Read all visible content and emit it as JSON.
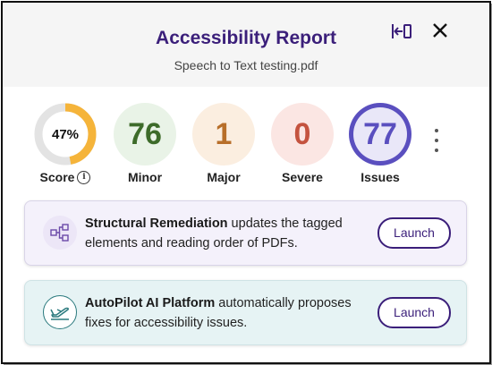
{
  "header": {
    "title": "Accessibility Report",
    "subtitle": "Speech to Text testing.pdf"
  },
  "metrics": [
    {
      "value": "47%",
      "label": "Score",
      "progress": 0.47,
      "ring_color": "#f5b43a",
      "track_color": "#e3e3e3"
    },
    {
      "value": "76",
      "label": "Minor",
      "bg": "#e9f3e7",
      "color": "#3d6b2a"
    },
    {
      "value": "1",
      "label": "Major",
      "bg": "#fbeee0",
      "color": "#b86f2a"
    },
    {
      "value": "0",
      "label": "Severe",
      "bg": "#fbe6e3",
      "color": "#c4533f"
    },
    {
      "value": "77",
      "label": "Issues",
      "bg": "#5a4fbf",
      "color": "#5a4fbf"
    }
  ],
  "cards": [
    {
      "title": "Structural Remediation",
      "description": " updates the tagged elements and reading order of PDFs.",
      "button": "Launch",
      "bg": "#f4f1fb",
      "icon": "structure-tree-icon"
    },
    {
      "title": "AutoPilot AI Platform",
      "description": " automatically proposes fixes for accessibility issues.",
      "button": "Launch",
      "bg": "#e6f3f4",
      "icon": "airplane-icon"
    }
  ],
  "colors": {
    "accent": "#3b1f7a"
  }
}
